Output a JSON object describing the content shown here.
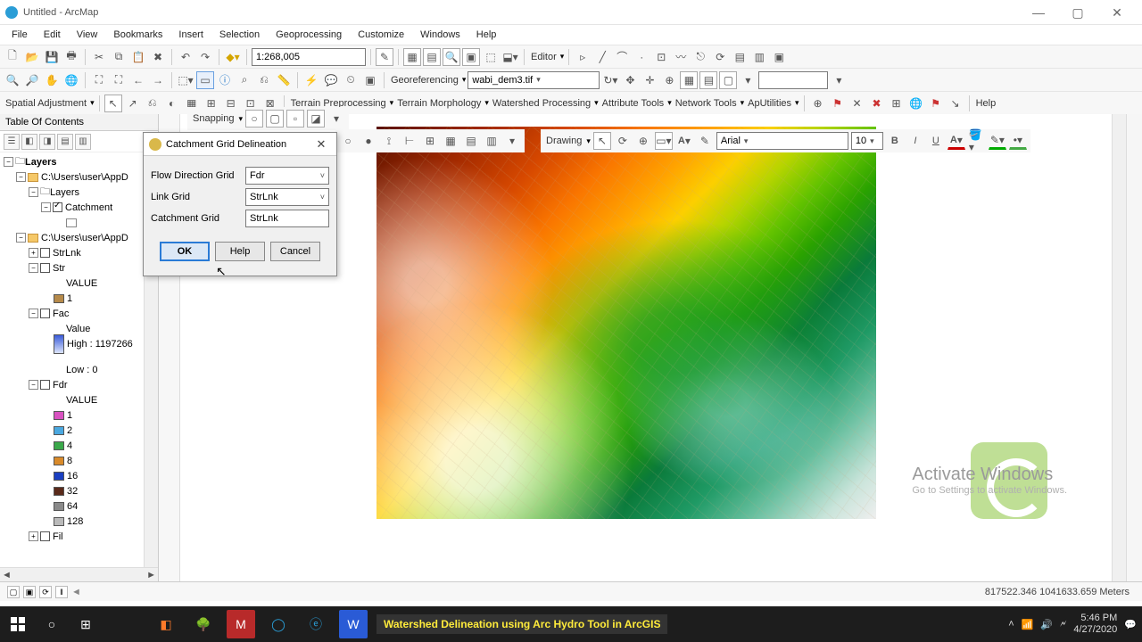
{
  "window": {
    "title": "Untitled - ArcMap"
  },
  "menu": [
    "File",
    "Edit",
    "View",
    "Bookmarks",
    "Insert",
    "Selection",
    "Geoprocessing",
    "Customize",
    "Windows",
    "Help"
  ],
  "scale": "1:268,005",
  "editor_label": "Editor",
  "georef": {
    "label": "Georeferencing",
    "source": "wabi_dem3.tif"
  },
  "spatial_adj": "Spatial Adjustment",
  "toolbar3": {
    "terrain_pre": "Terrain Preprocessing",
    "terrain_morph": "Terrain Morphology",
    "watershed": "Watershed Processing",
    "attr": "Attribute Tools",
    "network": "Network Tools",
    "aputil": "ApUtilities",
    "help": "Help"
  },
  "snapping": "Snapping",
  "drawing": {
    "label": "Drawing",
    "font": "Arial",
    "size": "10"
  },
  "toc": {
    "title": "Table Of Contents",
    "layers": "Layers",
    "group1": "C:\\Users\\user\\AppD",
    "group1_layers": "Layers",
    "catchment": "Catchment",
    "group2": "C:\\Users\\user\\AppD",
    "strlnk": "StrLnk",
    "str": "Str",
    "value": "VALUE",
    "v1": "1",
    "fac": "Fac",
    "fac_value": "Value",
    "fac_high": "High : 1197266",
    "fac_low": "Low : 0",
    "fdr": "Fdr",
    "fdr_values": [
      "1",
      "2",
      "4",
      "8",
      "16",
      "32",
      "64",
      "128"
    ],
    "fil": "Fil"
  },
  "dialog": {
    "title": "Catchment Grid Delineation",
    "flow_dir": "Flow Direction Grid",
    "flow_dir_val": "Fdr",
    "link_grid": "Link Grid",
    "link_grid_val": "StrLnk",
    "catch_grid": "Catchment Grid",
    "catch_grid_val": "StrLnk",
    "ok": "OK",
    "help": "Help",
    "cancel": "Cancel"
  },
  "watermark": {
    "l1": "Activate Windows",
    "l2": "Go to Settings to activate Windows."
  },
  "status": {
    "coords": "817522.346  1041633.659 Meters"
  },
  "taskbar": {
    "video": "Watershed Delineation using Arc Hydro Tool in ArcGIS",
    "time": "5:46 PM",
    "date": "4/27/2020"
  }
}
